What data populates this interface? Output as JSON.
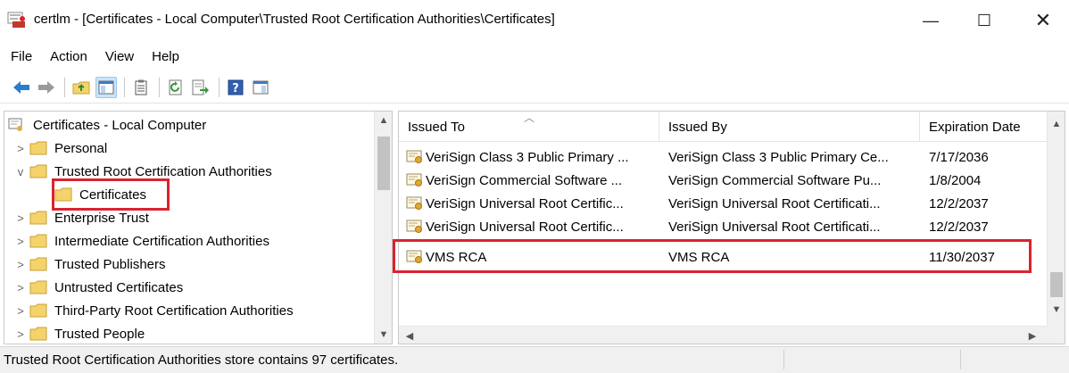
{
  "window": {
    "title": "certlm - [Certificates - Local Computer\\Trusted Root Certification Authorities\\Certificates]",
    "minimize_glyph": "—",
    "maximize_glyph": "☐",
    "close_glyph": "✕"
  },
  "menu": [
    "File",
    "Action",
    "View",
    "Help"
  ],
  "toolbar": {
    "buttons": [
      "back-arrow-icon",
      "forward-arrow-icon",
      "up-folder-icon",
      "show-hide-tree-icon",
      "clipboard-icon",
      "refresh-icon",
      "export-list-icon",
      "help-icon",
      "properties-icon"
    ]
  },
  "tree": {
    "root": "Certificates - Local Computer",
    "nodes": [
      {
        "label": "Personal",
        "expander": ">"
      },
      {
        "label": "Trusted Root Certification Authorities",
        "expander": "v"
      },
      {
        "label": "Certificates",
        "expander": ""
      },
      {
        "label": "Enterprise Trust",
        "expander": ">"
      },
      {
        "label": "Intermediate Certification Authorities",
        "expander": ">"
      },
      {
        "label": "Trusted Publishers",
        "expander": ">"
      },
      {
        "label": "Untrusted Certificates",
        "expander": ">"
      },
      {
        "label": "Third-Party Root Certification Authorities",
        "expander": ">"
      },
      {
        "label": "Trusted People",
        "expander": ">"
      }
    ]
  },
  "list": {
    "columns": [
      "Issued To",
      "Issued By",
      "Expiration Date"
    ],
    "rows": [
      {
        "issued_to": "VeriSign Class 3 Public Primary ...",
        "issued_by": "VeriSign Class 3 Public Primary Ce...",
        "expires": "7/17/2036"
      },
      {
        "issued_to": "VeriSign Commercial Software ...",
        "issued_by": "VeriSign Commercial Software Pu...",
        "expires": "1/8/2004"
      },
      {
        "issued_to": "VeriSign Universal Root Certific...",
        "issued_by": "VeriSign Universal Root Certificati...",
        "expires": "12/2/2037"
      },
      {
        "issued_to": "VeriSign Universal Root Certific...",
        "issued_by": "VeriSign Universal Root Certificati...",
        "expires": "12/2/2037"
      },
      {
        "issued_to": "VMS RCA",
        "issued_by": "VMS RCA",
        "expires": "11/30/2037"
      }
    ]
  },
  "status": {
    "text": "Trusted Root Certification Authorities store contains 97 certificates."
  },
  "colors": {
    "highlight_red": "#d9232e",
    "folder_yellow": "#f5d36b"
  }
}
